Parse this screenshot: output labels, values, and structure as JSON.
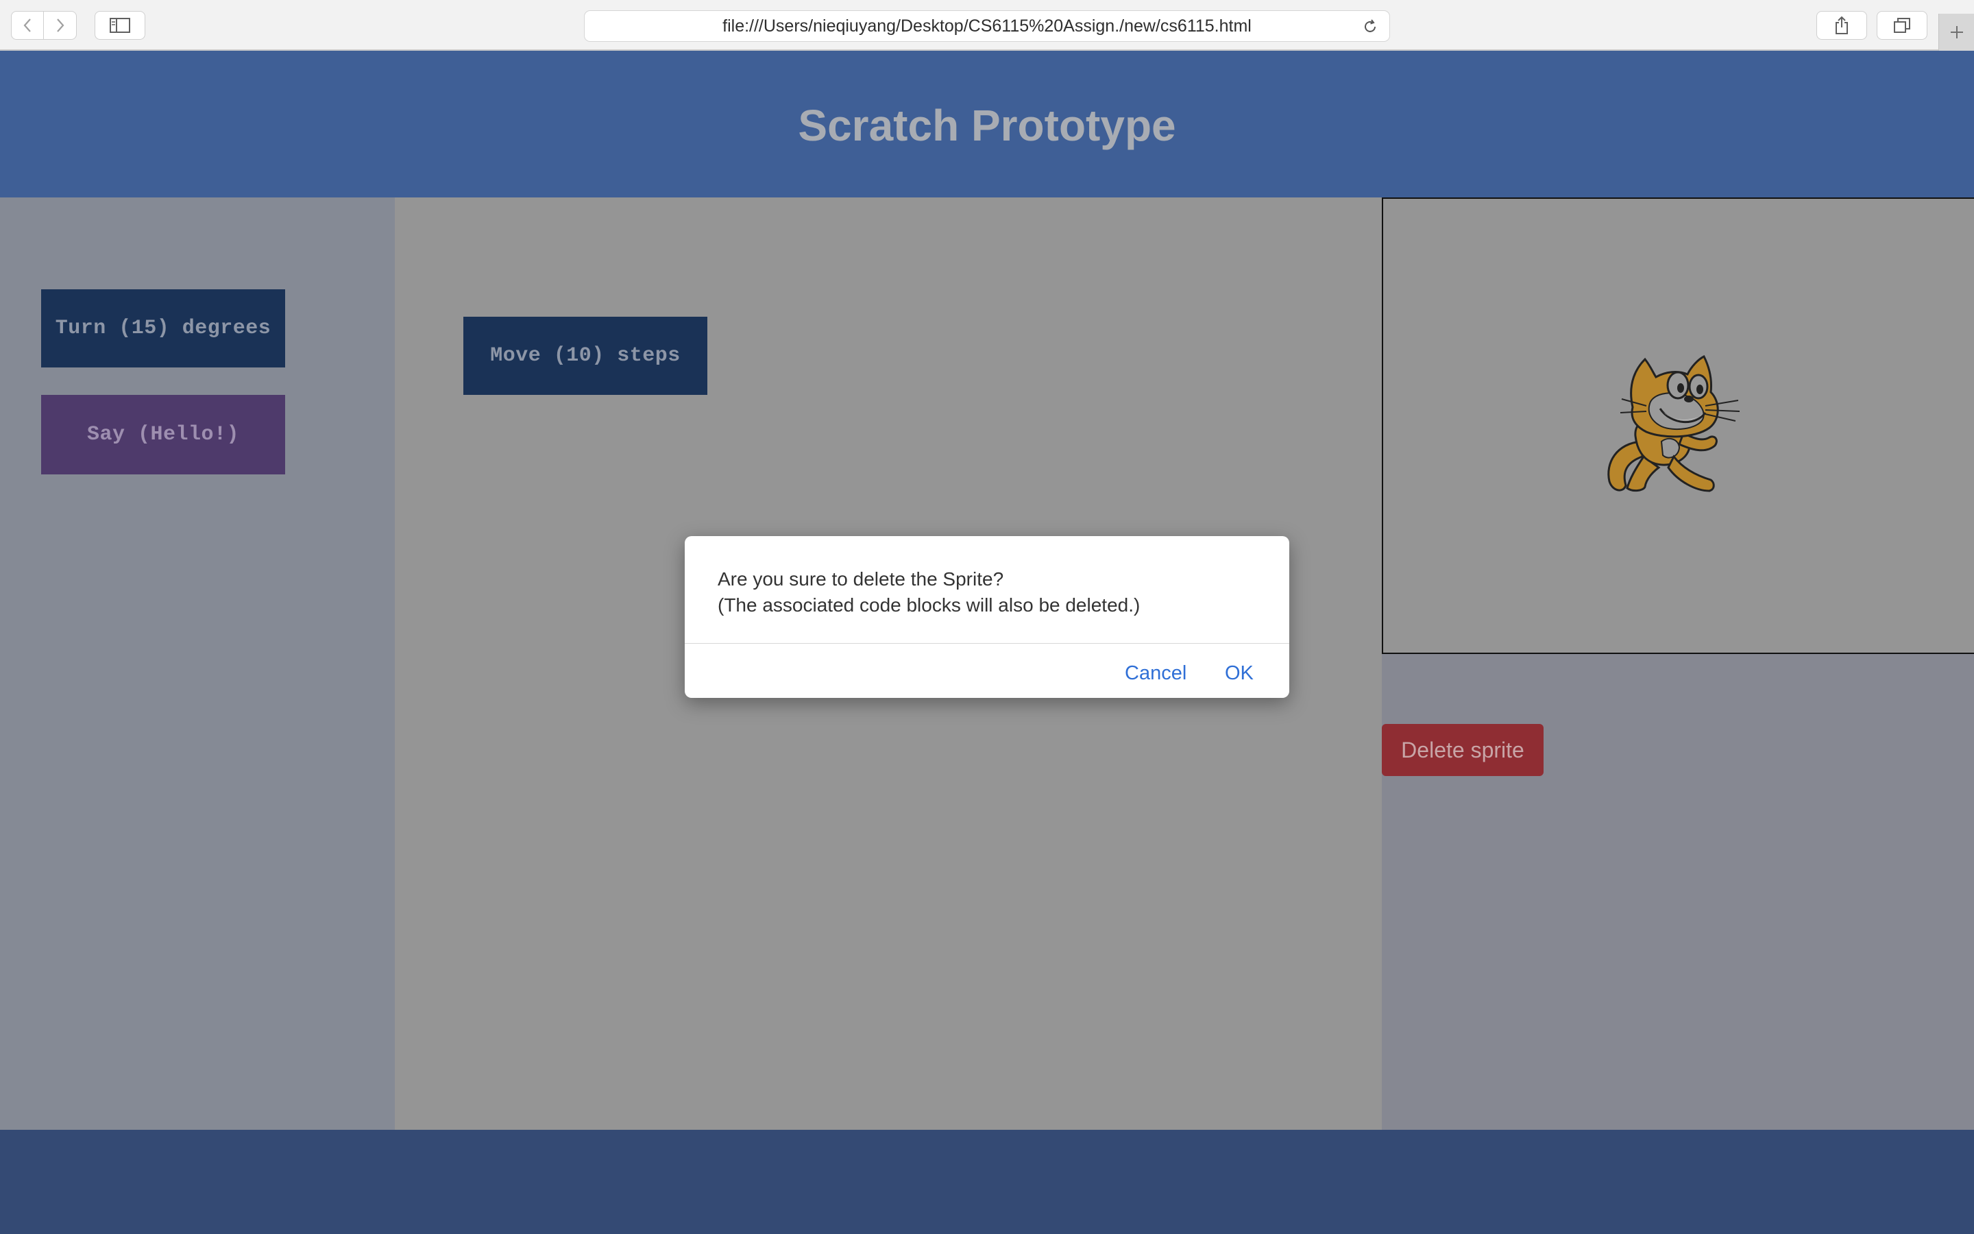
{
  "browser": {
    "url": "file:///Users/nieqiuyang/Desktop/CS6115%20Assign./new/cs6115.html",
    "icons": [
      "chevron-left-icon",
      "chevron-right-icon",
      "sidebar-icon",
      "reload-icon",
      "share-icon",
      "tabs-icon",
      "plus-icon"
    ]
  },
  "header": {
    "title": "Scratch Prototype"
  },
  "palette": {
    "blocks": [
      {
        "label": "Turn (15) degrees",
        "color": "#1a3256"
      },
      {
        "label": "Say (Hello!)",
        "color": "#4e3a6b"
      }
    ]
  },
  "workspace": {
    "blocks": [
      {
        "label": "Move (10) steps",
        "color": "#1a3256"
      }
    ]
  },
  "stage": {
    "sprite": "scratch-cat",
    "delete_label": "Delete sprite",
    "delete_color": "#8f2d33"
  },
  "dialog": {
    "line1": "Are you sure to delete the Sprite?",
    "line2": "(The associated code blocks will also be deleted.)",
    "cancel_label": "Cancel",
    "ok_label": "OK",
    "button_color": "#2f6fd6"
  },
  "colors": {
    "header": "#3f5f96",
    "footer": "#344a74",
    "palette": "#858a95",
    "workspace": "#959595"
  }
}
